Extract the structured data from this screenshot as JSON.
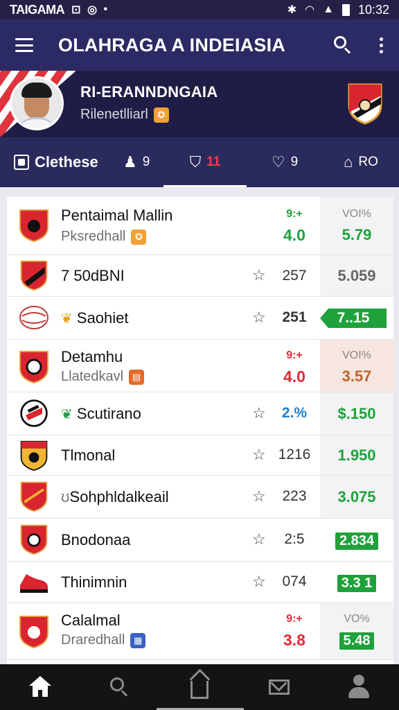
{
  "statusbar": {
    "carrier": "TAIGAMA",
    "time": "10:32"
  },
  "appbar": {
    "title": "OLAHRAGA A INDEIASIA"
  },
  "profile": {
    "name": "RI-ERANNDNGAIA",
    "subtitle": "Rilenetlliarl"
  },
  "tabs": [
    {
      "label": "Clethese",
      "icon": "news-icon"
    },
    {
      "count": "9",
      "icon": "trophy-icon"
    },
    {
      "count": "11",
      "icon": "bookmark-icon",
      "active": true
    },
    {
      "count": "9",
      "icon": "heart-icon"
    },
    {
      "count": "RO",
      "icon": "stadium-icon"
    }
  ],
  "rows": [
    {
      "name": "Pentaimal Mallin",
      "sub": "Pksredhall",
      "odds_top": "9:+",
      "odds_main": "4.0",
      "pct": "VOI%",
      "val": "5.79"
    },
    {
      "name": "7 50dBNI",
      "count": "257",
      "val": "5.059"
    },
    {
      "name": "Saohiet",
      "count": "251",
      "val": "7..15"
    },
    {
      "name": "Detamhu",
      "sub": "Llatedkavl",
      "odds_top": "9:+",
      "odds_main": "4.0",
      "pct": "VOI%",
      "val": "3.57"
    },
    {
      "name": "Scutirano",
      "count": "2.%",
      "val": "$.150"
    },
    {
      "name": "Tlmonal",
      "count": "1216",
      "val": "1.950"
    },
    {
      "name": "Sohphldalkeail",
      "count": "223",
      "val": "3.075"
    },
    {
      "name": "Bnodonaa",
      "count": "2:5",
      "val": "2.834"
    },
    {
      "name": "Thinimnin",
      "count": "074",
      "val": "3.3 1"
    },
    {
      "name": "Calalmal",
      "sub": "Draredhall",
      "odds_top": "9:+",
      "odds_main": "3.8",
      "pct": "VO%",
      "val": "5.48"
    }
  ],
  "colors": {
    "appbar": "#2b2a64",
    "accent_red": "#e02a34",
    "accent_green": "#1fa13b"
  }
}
